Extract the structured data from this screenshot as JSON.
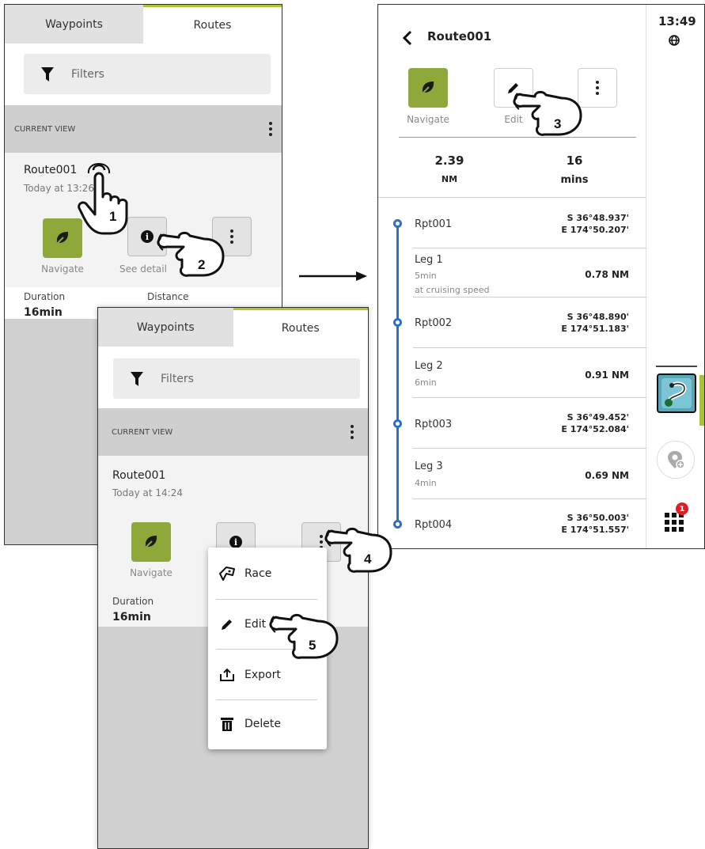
{
  "panel1": {
    "tabs": [
      "Waypoints",
      "Routes"
    ],
    "filter_label": "Filters",
    "current_view": "CURRENT VIEW",
    "route_name": "Route001",
    "route_time": "Today at 13:26",
    "navigate_label": "Navigate",
    "see_detail_label": "See detail",
    "duration_label": "Duration",
    "duration_value": "16min",
    "distance_label": "Distance"
  },
  "panel2": {
    "tabs": [
      "Waypoints",
      "Routes"
    ],
    "filter_label": "Filters",
    "current_view": "CURRENT VIEW",
    "route_name": "Route001",
    "route_time": "Today at 14:24",
    "navigate_label": "Navigate",
    "duration_label": "Duration",
    "duration_value": "16min",
    "menu": [
      "Race",
      "Edit",
      "Export",
      "Delete"
    ]
  },
  "panel3": {
    "title": "Route001",
    "clock": "13:49",
    "navigate_label": "Navigate",
    "edit_label": "Edit",
    "distance_value": "2.39",
    "distance_unit": "NM",
    "time_value": "16",
    "time_unit": "mins",
    "rows": [
      {
        "type": "point",
        "name": "Rpt001",
        "lat": "S 36°48.937'",
        "lon": "E 174°50.207'"
      },
      {
        "type": "leg",
        "name": "Leg 1",
        "time": "5min",
        "note": "at cruising speed",
        "dist": "0.78 NM"
      },
      {
        "type": "point",
        "name": "Rpt002",
        "lat": "S 36°48.890'",
        "lon": "E 174°51.183'"
      },
      {
        "type": "leg",
        "name": "Leg 2",
        "time": "6min",
        "dist": "0.91 NM"
      },
      {
        "type": "point",
        "name": "Rpt003",
        "lat": "S 36°49.452'",
        "lon": "E 174°52.084'"
      },
      {
        "type": "leg",
        "name": "Leg 3",
        "time": "4min",
        "dist": "0.69 NM"
      },
      {
        "type": "point",
        "name": "Rpt004",
        "lat": "S 36°50.003'",
        "lon": "E 174°51.557'"
      }
    ],
    "badge_count": "1"
  },
  "steps": [
    "1",
    "2",
    "3",
    "4",
    "5"
  ],
  "colors": {
    "accent": "#a8c432",
    "navigate_green": "#8fa83a",
    "route_blue": "#2f6fc6",
    "badge_red": "#e01b24"
  }
}
